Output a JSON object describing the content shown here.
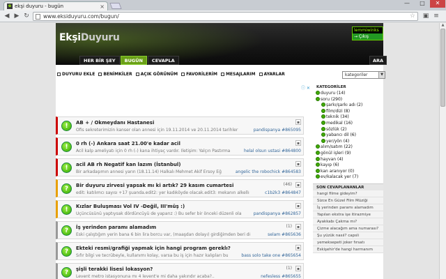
{
  "browser": {
    "tab_title": "ekşi duyuru - bugün",
    "url": "www.eksiduyuru.com/bugun/",
    "window_controls": [
      "—",
      "□",
      "✕"
    ]
  },
  "site": {
    "logo_bold": "Ekşi",
    "logo_rest": "Duyuru",
    "user_name": "lemmiwinks",
    "logout": "→ Çıkış",
    "nav": [
      "HER BİR ŞEY",
      "BUGÜN",
      "CEVAPLA"
    ],
    "search": "ARA",
    "menu": [
      "DUYURU EKLE",
      "BENİMKİLER",
      "AÇIK GÖRÜNÜM",
      "FAVORİLERİM",
      "MESAJLARIM",
      "AYARLAR"
    ],
    "category_select": "kategoriler",
    "ad_marker": "ⓘ ✕"
  },
  "feed": [
    {
      "title": "AB + / Okmeydanı Hastanesi",
      "subtitle": "Ofis sekreterimizin kanser olan annesi için 19.11.2014 ve 20.11.2014 tarihler",
      "user": "pandispanya #865095",
      "count": "",
      "icon": "!",
      "accent": "red"
    },
    {
      "title": "0 rh (-) Ankara saat 21.00'e kadar acil",
      "subtitle": "Acil kalp ameliyatı için 0 rh (-) kana ihtiyaç vardır. İletişim: Yalçın Pastırma",
      "user": "helal olsun ustasi #864800",
      "count": "",
      "icon": "!",
      "accent": "red"
    },
    {
      "title": "acil AB rh Negatif kan lazım (İstanbul)",
      "subtitle": "Bir arkadaşımın annesi yarın (18.11.14) Halkalı Mehmet Akif Ersoy Eğ",
      "user": "angelic the robochick #864583",
      "count": "",
      "icon": "!",
      "accent": "red"
    },
    {
      "title": "Bir duyuru zirvesi yapsak mı ki artık? 29 kasım cumartesi",
      "subtitle": "edit: katılımcı sayısı +17 şuanda.edit2: yer kadıköyde olacak.edit3: mekanın alkellı",
      "user": "c1b2k3 #864847",
      "count": "(46)",
      "icon": "?",
      "accent": "orange"
    },
    {
      "title": "Kızlar Buluşması Vol IV -Değil, III'müş :)",
      "subtitle": "Üçüncüsünü yaptıysak dördüncüyü de yaparız :) Bu sefer bir önceki düzenli ola",
      "user": "pandispanya #862857",
      "count": "",
      "icon": "!",
      "accent": "orange"
    },
    {
      "title": "İş yerinden paramı alamadım",
      "subtitle": "Eski çalıştığım yerin bana 6 bin lira borcu var, (maaşdan dolayı) girdiğimden beri düz",
      "user": "selam #865636",
      "count": "(1)",
      "icon": "?",
      "accent": "gray"
    },
    {
      "title": "Ekteki resmi/grafiği yapmak için hangi program gereklı?",
      "subtitle": "Sıfır bilgi ve tecrübeyle, kullanımı kolay, varsa bu iş için hazır kalıpları bu",
      "user": "bass solo take one #865654",
      "count": "",
      "icon": "?",
      "accent": "gray"
    },
    {
      "title": "şişli terakki lisesi lokasyon?",
      "subtitle": "Levent metro istasyonuna mı 4 levent'e mi daha yakındır acaba?..",
      "user": "nefesless #865655",
      "count": "(1)",
      "icon": "?",
      "accent": "gray"
    }
  ],
  "sidebar": {
    "categories_title": "KATEGORİLER",
    "categories": [
      {
        "name": "duyuru",
        "count": "(14)"
      },
      {
        "name": "soru",
        "count": "(290)"
      },
      {
        "name": "şarkı/şarkı adı",
        "count": "(2)"
      },
      {
        "name": "film/dizi",
        "count": "(8)"
      },
      {
        "name": "teknik",
        "count": "(34)"
      },
      {
        "name": "medikal",
        "count": "(16)"
      },
      {
        "name": "sözlük",
        "count": "(2)"
      },
      {
        "name": "yabancı dil",
        "count": "(6)"
      },
      {
        "name": "yer/yön",
        "count": "(4)"
      },
      {
        "name": "alım/satım",
        "count": "(22)"
      },
      {
        "name": "gönül işleri",
        "count": "(9)"
      },
      {
        "name": "hayvan",
        "count": "(4)"
      },
      {
        "name": "kayıp",
        "count": "(6)"
      },
      {
        "name": "kan aranıyor",
        "count": "(0)"
      },
      {
        "name": "ev/kalacak yer",
        "count": "(7)"
      }
    ],
    "recent_title": "SON CEVAPLANANLAR",
    "recent": [
      "hangi filme gideyim?",
      "Sizce En Güzel Film Müziği",
      "İş yerinden paramı alamadım",
      "Yapılan ekstra işe itirazmiye",
      "Ayakkabı Çakma mı?",
      "Çizme alacağım ama numarası?",
      "Şu yüzük nasıl? capsli",
      "yemeksepeti joker fırsatı",
      "Eskişehir'de hangi harmanım"
    ]
  }
}
